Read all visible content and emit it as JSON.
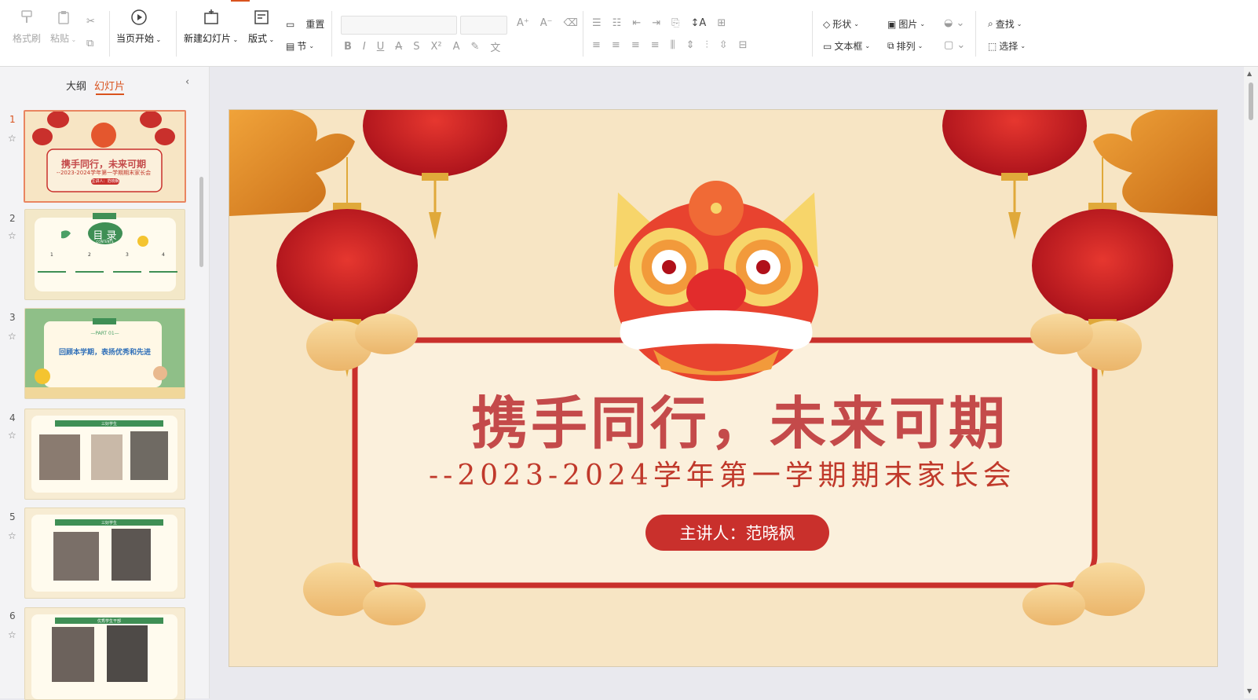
{
  "ribbon": {
    "format_painter": "格式刷",
    "paste": "粘贴",
    "start_from_current": "当页开始",
    "new_slide": "新建幻灯片",
    "layout": "版式",
    "reset": "重置",
    "section": "节",
    "shape": "形状",
    "picture": "图片",
    "textbox": "文本框",
    "arrange": "排列",
    "find": "查找",
    "select": "选择"
  },
  "sidebar": {
    "tab_outline": "大纲",
    "tab_slides": "幻灯片",
    "slides": [
      {
        "num": "1",
        "title": "携手同行，未来可期",
        "sub": "--2023-2024学年第一学期期末家长会",
        "pill": "主讲人：范晓枫"
      },
      {
        "num": "2",
        "title": "目 录",
        "sub": "CONTENTS",
        "items": [
          "1",
          "2",
          "3",
          "4"
        ]
      },
      {
        "num": "3",
        "title": "回顾本学期，表扬优秀和先进",
        "sub": "—PART 01—"
      },
      {
        "num": "4",
        "title": "三好学生",
        "sub": ""
      },
      {
        "num": "5",
        "title": "三好学生",
        "sub": ""
      },
      {
        "num": "6",
        "title": "优秀学生干部",
        "sub": ""
      }
    ]
  },
  "slide": {
    "title": "携手同行，未来可期",
    "subtitle": "--2023-2024学年第一学期期末家长会",
    "speaker": "主讲人：范晓枫"
  },
  "colors": {
    "accent": "#d9531e",
    "slide_bg": "#f7e5c4",
    "title_red": "#c44a4a",
    "frame_red": "#c9302c"
  }
}
